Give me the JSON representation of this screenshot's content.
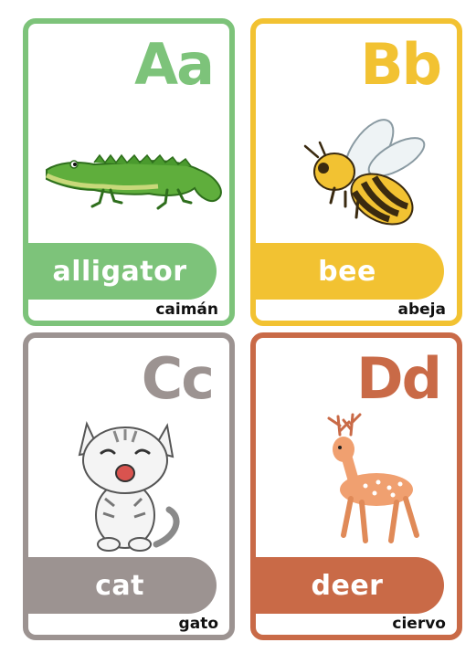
{
  "cards": [
    {
      "letters": "Aa",
      "word": "alligator",
      "spanish": "caimán",
      "color": "#7dc37a",
      "animal_icon": "alligator-icon"
    },
    {
      "letters": "Bb",
      "word": "bee",
      "spanish": "abeja",
      "color": "#f2c232",
      "animal_icon": "bee-icon"
    },
    {
      "letters": "Cc",
      "word": "cat",
      "spanish": "gato",
      "color": "#9c9391",
      "animal_icon": "cat-icon"
    },
    {
      "letters": "Dd",
      "word": "deer",
      "spanish": "ciervo",
      "color": "#c96a47",
      "animal_icon": "deer-icon"
    }
  ]
}
